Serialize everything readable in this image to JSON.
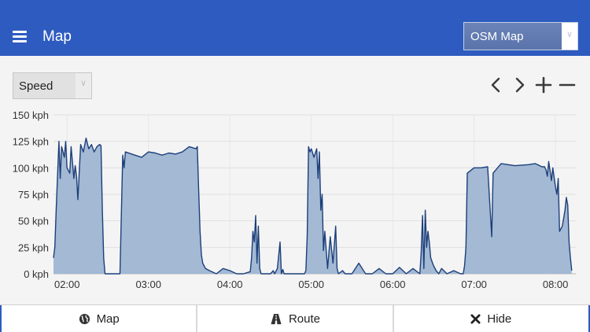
{
  "header": {
    "title": "Map",
    "map_select": {
      "selected": "OSM Map"
    }
  },
  "controls": {
    "metric_select": {
      "selected": "Speed"
    },
    "icons": [
      "chevron-left-icon",
      "chevron-right-icon",
      "plus-icon",
      "minus-icon"
    ]
  },
  "colors": {
    "appbar": "#2d5bc0",
    "series_line": "#1d3f7a",
    "series_fill": "#9eb5d2"
  },
  "chart_data": {
    "type": "area",
    "title": "",
    "xlabel": "",
    "ylabel": "",
    "x_unit": "time",
    "xlim": [
      "01:50",
      "08:15"
    ],
    "ylim": [
      0,
      150
    ],
    "yticks": [
      0,
      25,
      50,
      75,
      100,
      125,
      150
    ],
    "ytick_labels": [
      "0 kph",
      "25 kph",
      "50 kph",
      "75 kph",
      "100 kph",
      "125 kph",
      "150 kph"
    ],
    "xtick_labels": [
      "02:00",
      "03:00",
      "04:00",
      "05:00",
      "06:00",
      "07:00",
      "08:00"
    ],
    "grid": true,
    "series": [
      {
        "x": [
          "01:50",
          "01:51",
          "01:52",
          "01:54",
          "01:55",
          "01:56",
          "01:58",
          "01:59",
          "02:00",
          "02:02",
          "02:03",
          "02:05",
          "02:06",
          "02:07",
          "02:08",
          "02:10",
          "02:12",
          "02:14",
          "02:16",
          "02:18",
          "02:20",
          "02:22",
          "02:24",
          "02:25",
          "02:26",
          "02:27",
          "02:28",
          "02:30",
          "02:35",
          "02:39",
          "02:41",
          "02:42",
          "02:43",
          "02:50",
          "02:55",
          "03:00",
          "03:05",
          "03:10",
          "03:15",
          "03:20",
          "03:25",
          "03:30",
          "03:35",
          "03:36",
          "03:37",
          "03:38",
          "03:39",
          "03:40",
          "03:42",
          "03:45",
          "03:50",
          "03:55",
          "04:00",
          "04:05",
          "04:10",
          "04:15",
          "04:16",
          "04:17",
          "04:18",
          "04:19",
          "04:20",
          "04:21",
          "04:22",
          "04:23",
          "04:25",
          "04:30",
          "04:32",
          "04:33",
          "04:35",
          "04:37",
          "04:38",
          "04:39",
          "04:40",
          "04:45",
          "04:50",
          "04:55",
          "04:56",
          "04:57",
          "04:58",
          "04:59",
          "05:00",
          "05:02",
          "05:04",
          "05:05",
          "05:06",
          "05:07",
          "05:08",
          "05:09",
          "05:10",
          "05:12",
          "05:14",
          "05:16",
          "05:18",
          "05:19",
          "05:20",
          "05:23",
          "05:25",
          "05:30",
          "05:35",
          "05:40",
          "05:45",
          "05:50",
          "05:55",
          "06:00",
          "06:05",
          "06:10",
          "06:15",
          "06:20",
          "06:21",
          "06:22",
          "06:23",
          "06:24",
          "06:25",
          "06:26",
          "06:27",
          "06:28",
          "06:30",
          "06:32",
          "06:34",
          "06:36",
          "06:40",
          "06:45",
          "06:50",
          "06:52",
          "06:53",
          "06:54",
          "06:55",
          "07:00",
          "07:05",
          "07:10",
          "07:13",
          "07:14",
          "07:20",
          "07:30",
          "07:40",
          "07:45",
          "07:50",
          "07:52",
          "07:53",
          "07:54",
          "07:55",
          "07:57",
          "07:58",
          "08:00",
          "08:01",
          "08:02",
          "08:03",
          "08:05",
          "08:07",
          "08:08",
          "08:09",
          "08:10",
          "08:11",
          "08:12"
        ],
        "y": [
          15,
          25,
          60,
          125,
          90,
          120,
          110,
          125,
          100,
          95,
          120,
          90,
          102,
          92,
          70,
          122,
          115,
          128,
          118,
          122,
          115,
          120,
          122,
          121,
          60,
          15,
          0,
          0,
          0,
          0,
          112,
          100,
          115,
          112,
          110,
          115,
          114,
          112,
          114,
          113,
          115,
          120,
          118,
          120,
          80,
          40,
          18,
          10,
          5,
          3,
          0,
          5,
          3,
          0,
          0,
          2,
          15,
          40,
          30,
          55,
          10,
          45,
          5,
          0,
          0,
          0,
          3,
          0,
          5,
          30,
          0,
          4,
          0,
          0,
          0,
          0,
          3,
          35,
          120,
          115,
          118,
          110,
          118,
          90,
          115,
          60,
          75,
          22,
          40,
          5,
          35,
          10,
          45,
          5,
          0,
          3,
          0,
          0,
          10,
          0,
          0,
          5,
          0,
          0,
          6,
          0,
          5,
          0,
          20,
          55,
          5,
          60,
          25,
          40,
          30,
          15,
          8,
          3,
          0,
          5,
          0,
          3,
          0,
          0,
          8,
          25,
          95,
          100,
          100,
          101,
          35,
          95,
          104,
          102,
          103,
          104,
          101,
          101,
          98,
          92,
          106,
          88,
          100,
          82,
          75,
          90,
          40,
          45,
          60,
          72,
          65,
          30,
          15,
          3
        ]
      }
    ]
  },
  "bottom_bar": {
    "items": [
      {
        "label": "Map",
        "icon": "globe-icon"
      },
      {
        "label": "Route",
        "icon": "road-icon"
      },
      {
        "label": "Hide",
        "icon": "close-icon"
      }
    ]
  }
}
